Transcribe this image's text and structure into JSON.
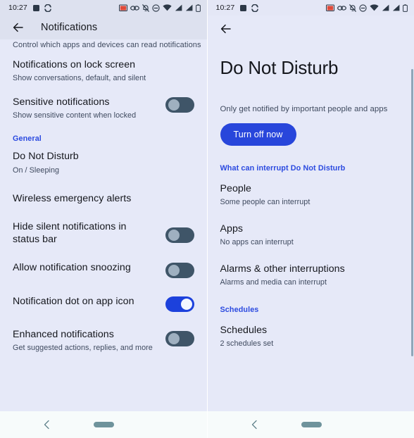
{
  "status_bar": {
    "time": "10:27",
    "left_icons": [
      "square-icon",
      "sync-arrows-icon"
    ],
    "right_icons": [
      "cast-icon",
      "link-icon",
      "vibrate-off-icon",
      "do-not-disturb-icon",
      "wifi-icon",
      "signal-icon",
      "signal-icon-2",
      "battery-icon"
    ],
    "cast_icon_color": "#e04a3a"
  },
  "colors": {
    "accent_blue": "#2b4ae0",
    "toggle_on": "#1c41dc",
    "toggle_off_track": "#3f5568",
    "toggle_off_knob": "#9fb0c0",
    "button_blue": "#2846db",
    "background": "#e6e9f8",
    "toolbar_background": "#dde1ef",
    "navbar_background": "#f7fbfb",
    "title_text": "#15171d",
    "subtitle_text": "#3f4a5f"
  },
  "left_screen": {
    "toolbar": {
      "back_label": "back-arrow",
      "title": "Notifications"
    },
    "partial_row": "Control which apps and devices can read notifications",
    "items": [
      {
        "type": "item",
        "title": "Notifications on lock screen",
        "subtitle": "Show conversations, default, and silent",
        "toggle": null
      },
      {
        "type": "item",
        "title": "Sensitive notifications",
        "subtitle": "Show sensitive content when locked",
        "toggle": "off"
      },
      {
        "type": "section",
        "title": "General"
      },
      {
        "type": "item",
        "title": "Do Not Disturb",
        "subtitle": "On / Sleeping",
        "toggle": null
      },
      {
        "type": "item",
        "title": "Wireless emergency alerts",
        "subtitle": "",
        "toggle": null
      },
      {
        "type": "item",
        "title": "Hide silent notifications in status bar",
        "subtitle": "",
        "toggle": "off"
      },
      {
        "type": "item",
        "title": "Allow notification snoozing",
        "subtitle": "",
        "toggle": "off"
      },
      {
        "type": "item",
        "title": "Notification dot on app icon",
        "subtitle": "",
        "toggle": "on"
      },
      {
        "type": "item",
        "title": "Enhanced notifications",
        "subtitle": "Get suggested actions, replies, and more",
        "toggle": "off"
      }
    ]
  },
  "right_screen": {
    "toolbar": {
      "back_label": "back-arrow",
      "title": ""
    },
    "page_title": "Do Not Disturb",
    "description": "Only get notified by important people and apps",
    "primary_button": "Turn off now",
    "items": [
      {
        "type": "section",
        "title": "What can interrupt Do Not Disturb"
      },
      {
        "type": "item",
        "title": "People",
        "subtitle": "Some people can interrupt"
      },
      {
        "type": "item",
        "title": "Apps",
        "subtitle": "No apps can interrupt"
      },
      {
        "type": "item",
        "title": "Alarms & other interruptions",
        "subtitle": "Alarms and media can interrupt"
      },
      {
        "type": "section",
        "title": "Schedules"
      },
      {
        "type": "item",
        "title": "Schedules",
        "subtitle": "2 schedules set"
      }
    ]
  },
  "nav_bar": {
    "back": "nav-back-icon",
    "home": "home-handle"
  }
}
